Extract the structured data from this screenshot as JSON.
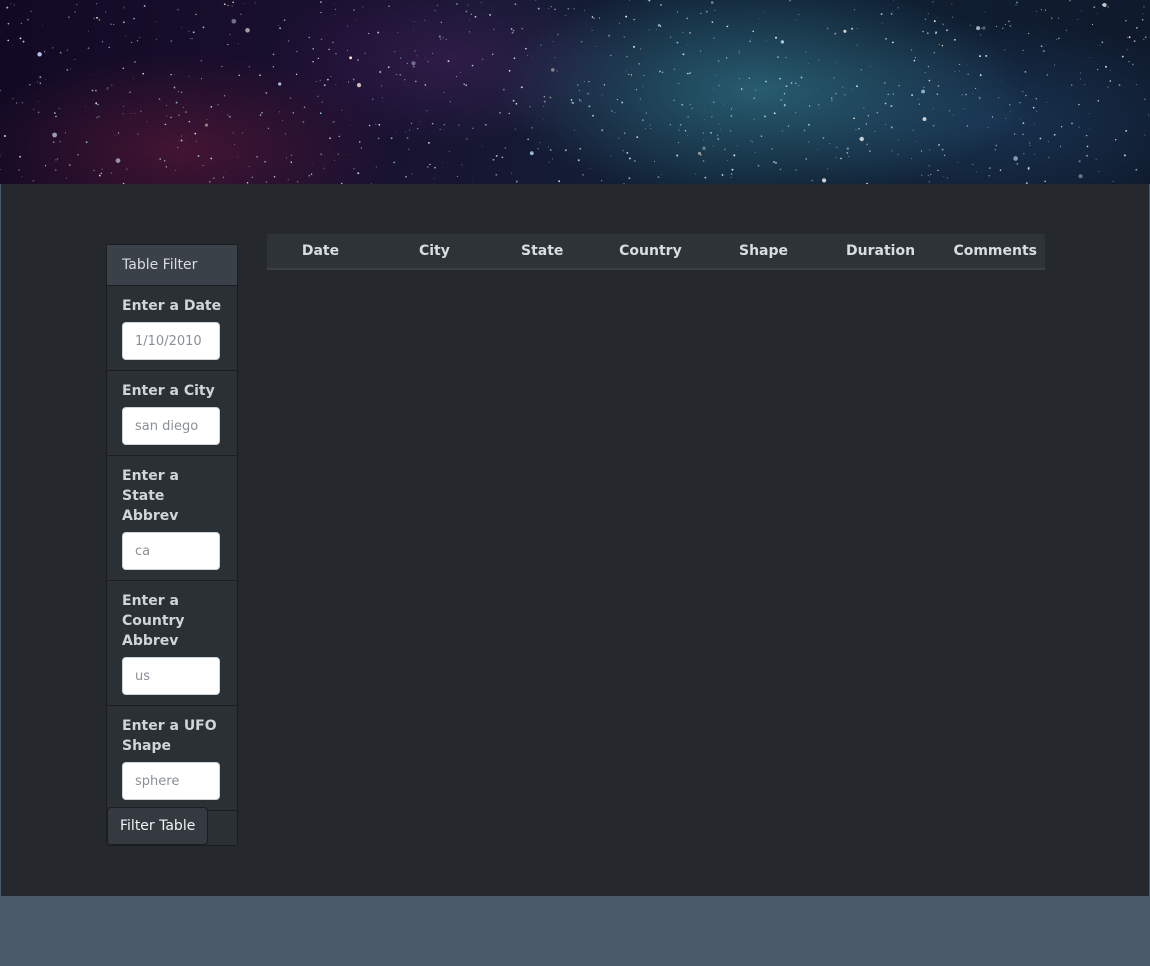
{
  "sidebar": {
    "header": "Table Filter",
    "filters": [
      {
        "label": "Enter a Date",
        "placeholder": "1/10/2010"
      },
      {
        "label": "Enter a City",
        "placeholder": "san diego"
      },
      {
        "label": "Enter a State Abbrev",
        "placeholder": "ca"
      },
      {
        "label": "Enter a Country Abbrev",
        "placeholder": "us"
      },
      {
        "label": "Enter a UFO Shape",
        "placeholder": "sphere"
      }
    ],
    "button_label": "Filter Table"
  },
  "table": {
    "columns": [
      "Date",
      "City",
      "State",
      "Country",
      "Shape",
      "Duration",
      "Comments"
    ],
    "rows": []
  },
  "colors": {
    "main_bg": "#25282c",
    "footer_bg": "#4b5a68",
    "panel_bg": "#2b3035"
  }
}
